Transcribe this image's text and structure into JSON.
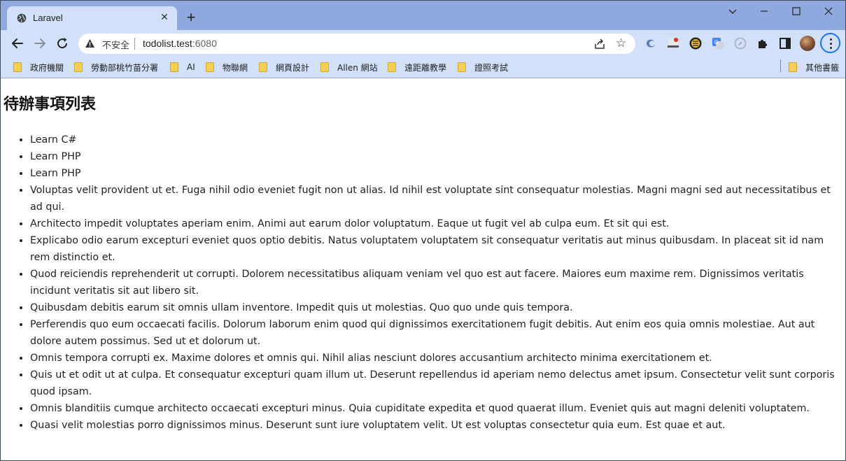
{
  "browser": {
    "tab": {
      "title": "Laravel",
      "favicon": "globe-icon"
    },
    "new_tab_icon": "plus-icon",
    "window_controls": [
      "chevron-down-icon",
      "minimize-icon",
      "maximize-icon",
      "close-icon"
    ],
    "address_bar": {
      "security_label": "不安全",
      "host": "todolist.test",
      "port": ":6080"
    },
    "bookmarks": [
      "政府機關",
      "勞動部桃竹苗分署",
      "AI",
      "物聯網",
      "網頁設計",
      "Allen 網站",
      "遠距離教學",
      "證照考試"
    ],
    "other_bookmarks": "其他書籤",
    "colors": {
      "tabstrip": "#8fa9df",
      "toolbar": "#d3e0fa",
      "accent": "#1a73e8"
    }
  },
  "page": {
    "heading": "待辦事項列表",
    "todos": [
      "Learn C#",
      "Learn PHP",
      "Learn PHP",
      "Voluptas velit provident ut et. Fuga nihil odio eveniet fugit non ut alias. Id nihil est voluptate sint consequatur molestias. Magni magni sed aut necessitatibus et ad qui.",
      "Architecto impedit voluptates aperiam enim. Animi aut earum dolor voluptatum. Eaque ut fugit vel ab culpa eum. Et sit qui est.",
      "Explicabo odio earum excepturi eveniet quos optio debitis. Natus voluptatem voluptatem sit consequatur veritatis aut minus quibusdam. In placeat sit id nam rem distinctio et.",
      "Quod reiciendis reprehenderit ut corrupti. Dolorem necessitatibus aliquam veniam vel quo est aut facere. Maiores eum maxime rem. Dignissimos veritatis incidunt veritatis sit aut libero sit.",
      "Quibusdam debitis earum sit omnis ullam inventore. Impedit quis ut molestias. Quo quo unde quis tempora.",
      "Perferendis quo eum occaecati facilis. Dolorum laborum enim quod qui dignissimos exercitationem fugit debitis. Aut enim eos quia omnis molestiae. Aut aut dolore autem possimus. Sed ut et dolorum ut.",
      "Omnis tempora corrupti ex. Maxime dolores et omnis qui. Nihil alias nesciunt dolores accusantium architecto minima exercitationem et.",
      "Quis ut et odit ut at culpa. Et consequatur excepturi quam illum ut. Deserunt repellendus id aperiam nemo delectus amet ipsum. Consectetur velit sunt corporis quod ipsam.",
      "Omnis blanditiis cumque architecto occaecati excepturi minus. Quia cupiditate expedita et quod quaerat illum. Eveniet quis aut magni deleniti voluptatem.",
      "Quasi velit molestias porro dignissimos minus. Deserunt sunt iure voluptatem velit. Ut est voluptas consectetur quia eum. Est quae et aut."
    ]
  }
}
